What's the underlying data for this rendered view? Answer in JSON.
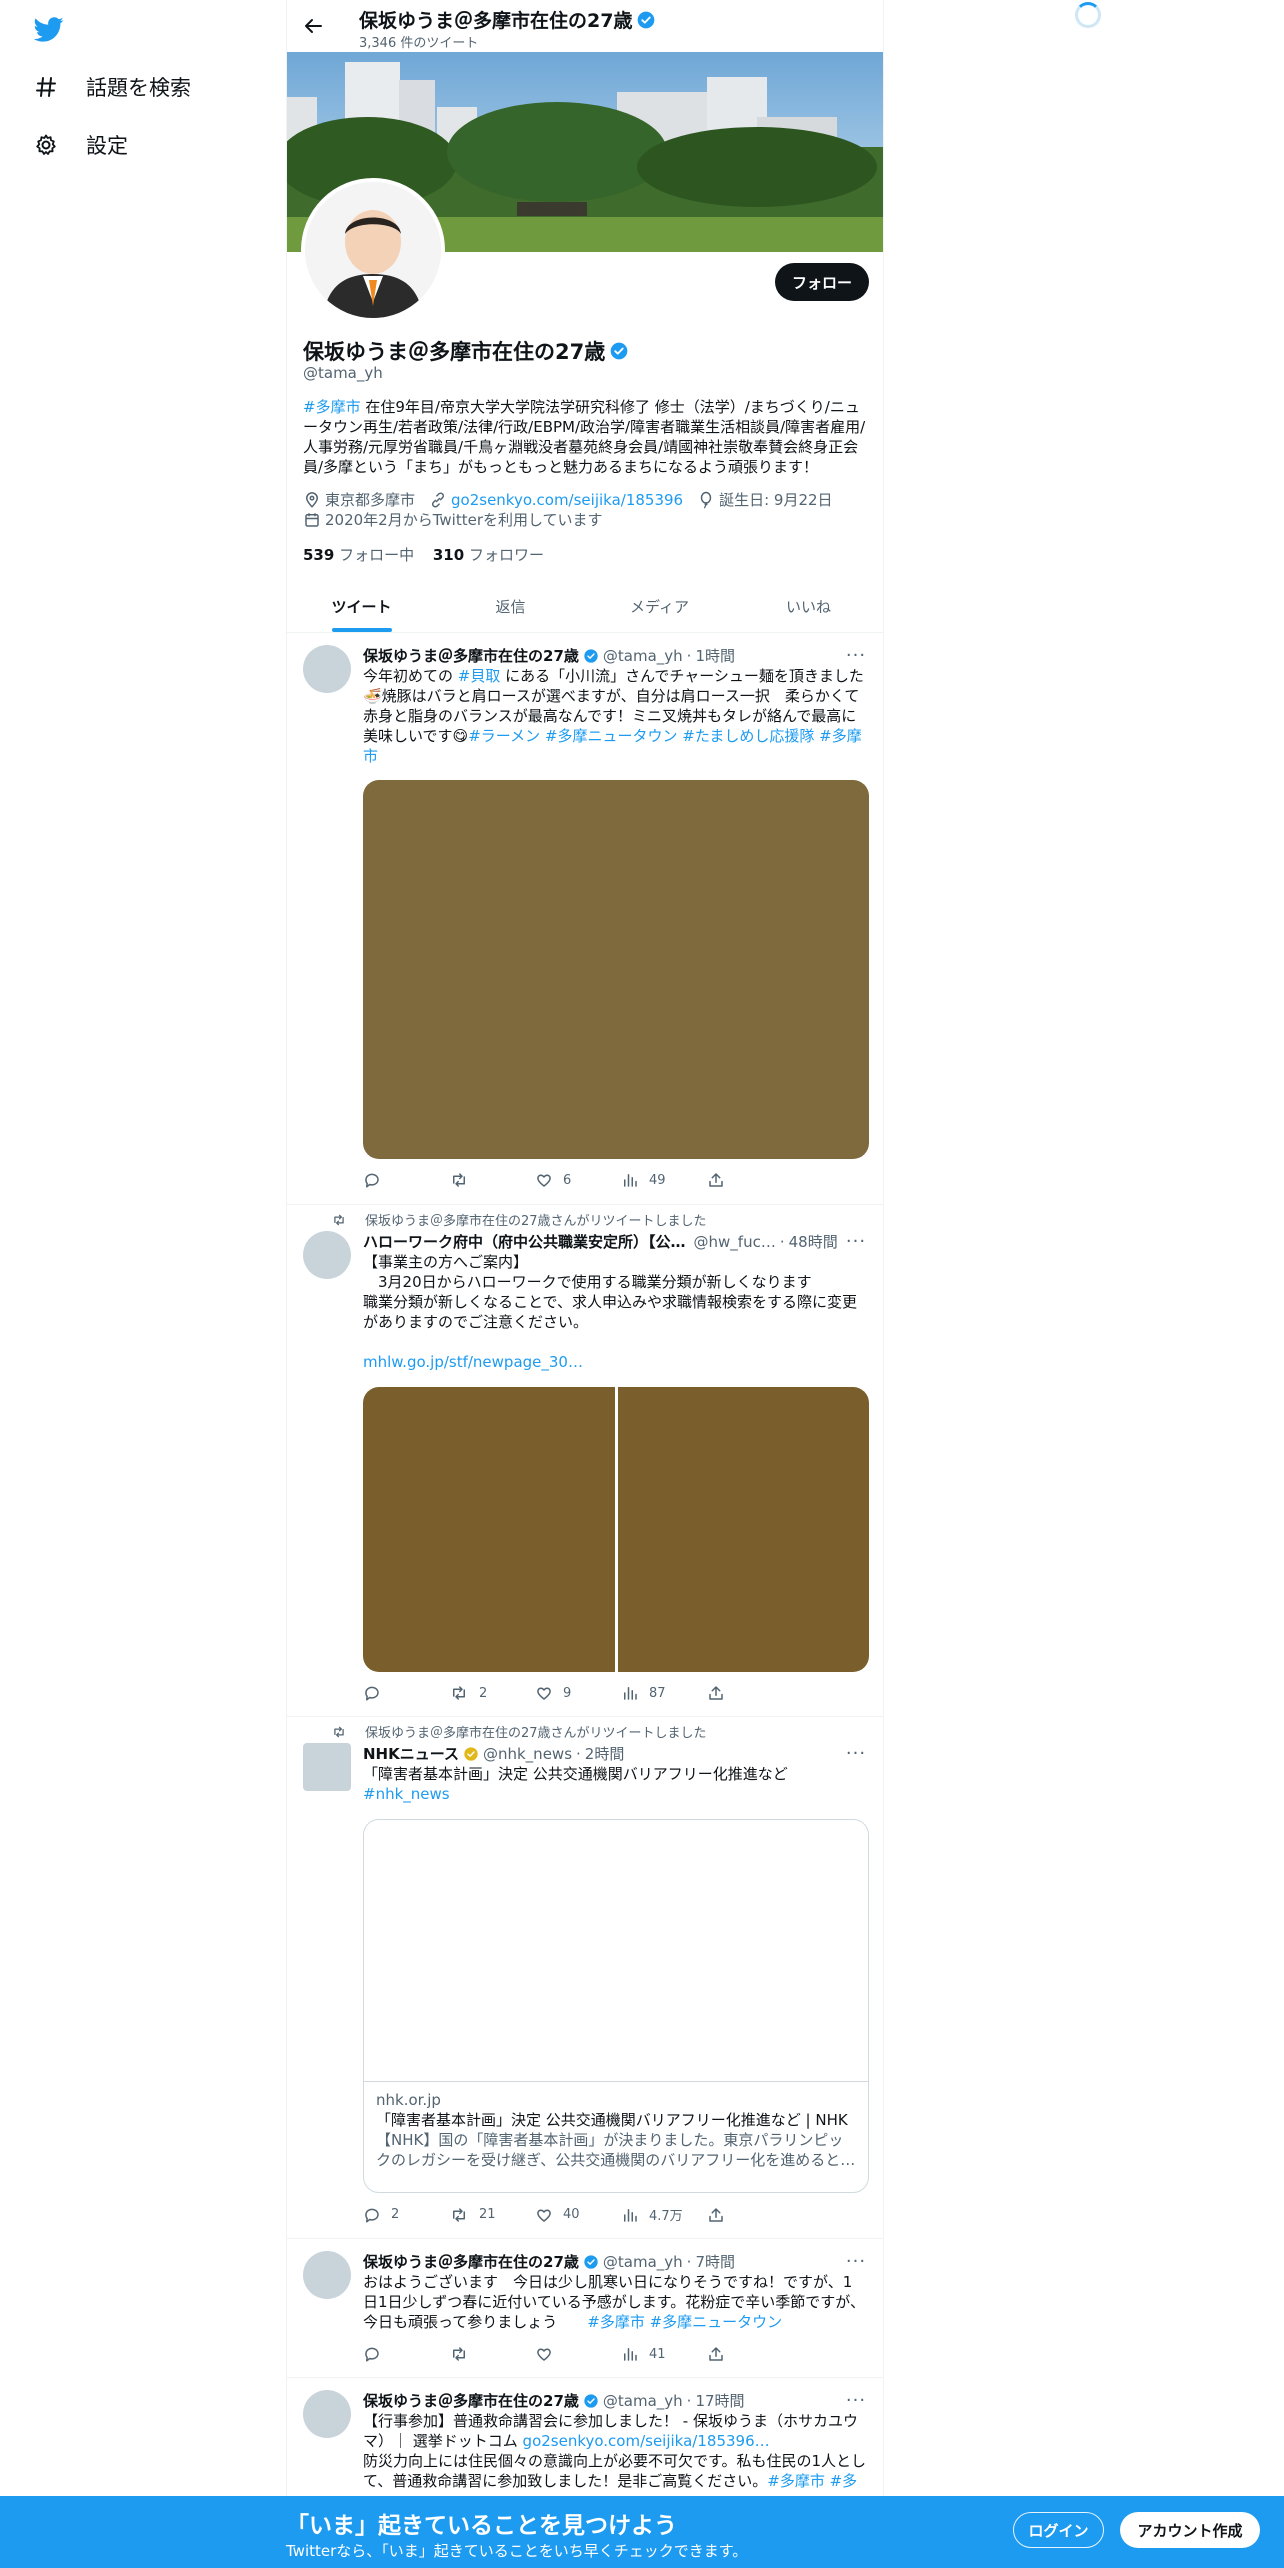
{
  "nav": {
    "logo_icon": "twitter-bird-icon",
    "items": [
      {
        "icon": "hashtag-icon",
        "label": "話題を検索"
      },
      {
        "icon": "gear-icon",
        "label": "設定"
      }
    ]
  },
  "header": {
    "name": "保坂ゆうま＠多摩市在住の27歳",
    "tweet_count": "3,346 件のツイート"
  },
  "profile": {
    "name": "保坂ゆうま＠多摩市在住の27歳",
    "handle": "@tama_yh",
    "follow_label": "フォロー",
    "bio_tag": "#多摩市",
    "bio_text": " 在住9年目/帝京大学大学院法学研究科修了 修士（法学）/まちづくり/ニュータウン再生/若者政策/法律/行政/EBPM/政治学/障害者職業生活相談員/障害者雇用/人事労務/元厚労省職員/千鳥ヶ淵戦没者墓苑終身会員/靖國神社崇敬奉賛会終身正会員/多摩という「まち」がもっともっと魅力あるまちになるよう頑張ります！",
    "location": "東京都多摩市",
    "website": "go2senkyo.com/seijika/185396",
    "birthday": "誕生日: 9月22日",
    "joined": "2020年2月からTwitterを利用しています",
    "following_count": "539",
    "following_label": " フォロー中",
    "followers_count": "310",
    "followers_label": " フォロワー"
  },
  "tabs": [
    "ツイート",
    "返信",
    "メディア",
    "いいね"
  ],
  "tweets": [
    {
      "name": "保坂ゆうま＠多摩市在住の27歳",
      "handle": "@tama_yh",
      "time": "1時間",
      "text_1": "今年初めての ",
      "tag_1": "#貝取",
      "text_2": " にある「小川流」さんでチャーシュー麺を頂きました🍜焼豚はバラと肩ロースが選べますが、自分は肩ロース一択　柔らかくて赤身と脂身のバランスが最高なんです！ミニ叉焼丼もタレが絡んで最高に美味しいです😋",
      "tags_end": "#ラーメン #多摩ニュータウン #たましめし応援隊 #多摩市",
      "replies": "",
      "retweets": "",
      "likes": "6",
      "views": "49"
    },
    {
      "retweeted_by": "保坂ゆうま＠多摩市在住の27歳さんがリツイートしました",
      "name": "ハローワーク府中（府中公共職業安定所）【公…",
      "handle": "@hw_fuc…",
      "time": "48時間",
      "line_1": "【事業主の方へご案内】",
      "line_2": "　3月20日からハローワークで使用する職業分類が新しくなります",
      "line_3": "職業分類が新しくなることで、求人申込みや求職情報検索をする際に変更がありますのでご注意ください。",
      "link": "mhlw.go.jp/stf/newpage_30…",
      "replies": "",
      "retweets": "2",
      "likes": "9",
      "views": "87"
    },
    {
      "retweeted_by": "保坂ゆうま＠多摩市在住の27歳さんがリツイートしました",
      "name": "NHKニュース",
      "handle": "@nhk_news",
      "time": "2時間",
      "text": "「障害者基本計画」決定 公共交通機関バリアフリー化推進など",
      "tag": "#nhk_news",
      "card_domain": "nhk.or.jp",
      "card_title": "「障害者基本計画」決定 公共交通機関バリアフリー化推進など | NHK",
      "card_desc": "【NHK】国の「障害者基本計画」が決まりました。東京パラリンピックのレガシーを受け継ぎ、公共交通機関のバリアフリー化を進めると…",
      "replies": "2",
      "retweets": "21",
      "likes": "40",
      "views": "4.7万"
    },
    {
      "name": "保坂ゆうま＠多摩市在住の27歳",
      "handle": "@tama_yh",
      "time": "7時間",
      "text": "おはようございます　今日は少し肌寒い日になりそうですね！ですが、1日1日少しずつ春に近付いている予感がします。花粉症で辛い季節ですが、今日も頑張って参りましょう　　",
      "tags": "#多摩市 #多摩ニュータウン",
      "replies": "",
      "retweets": "",
      "likes": "",
      "views": "41"
    },
    {
      "name": "保坂ゆうま＠多摩市在住の27歳",
      "handle": "@tama_yh",
      "time": "17時間",
      "text_1": "【行事参加】普通救命講習会に参加しました！ - 保坂ゆうま（ホサカユウマ）｜ 選挙ドットコム ",
      "link": "go2senkyo.com/seijika/185396…",
      "text_2": "防災力向上には住民個々の意識向上が必要不可欠です。私も住民の1人として、普通救命講習に参加致しました！是非ご高覧ください。",
      "tags": "#多摩市 #多"
    }
  ],
  "bottom_bar": {
    "title": "「いま」起きていることを見つけよう",
    "subtitle": "Twitterなら、「いま」起きていることをいち早くチェックできます。",
    "login": "ログイン",
    "signup": "アカウント作成"
  }
}
